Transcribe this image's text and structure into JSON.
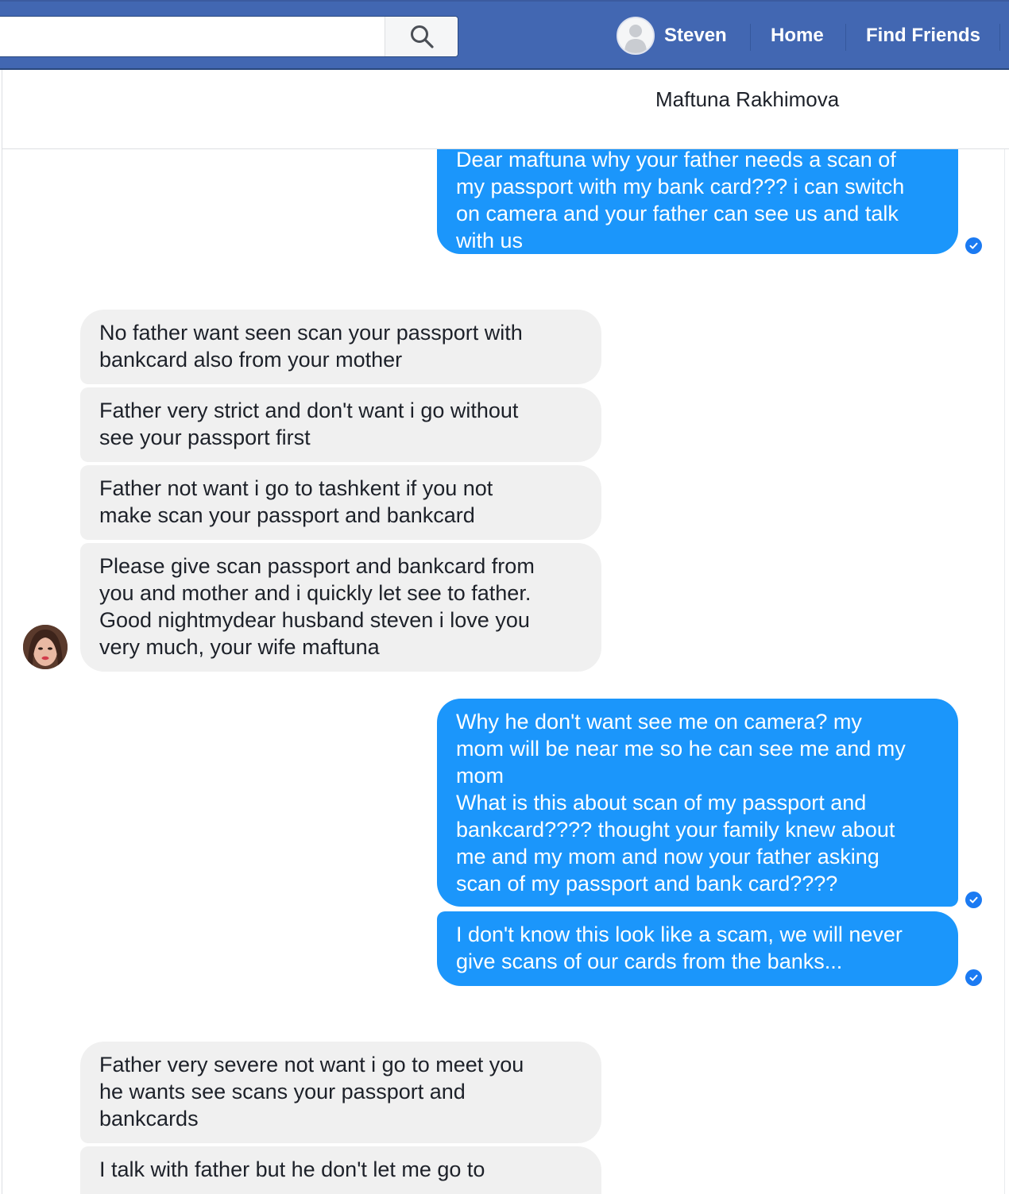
{
  "topbar": {
    "search_placeholder": "",
    "profile_name": "Steven",
    "home_label": "Home",
    "find_friends_label": "Find Friends",
    "brand_color": "#4267b2"
  },
  "conversation": {
    "title": "Maftuna Rakhimova"
  },
  "messages": [
    {
      "from": "me",
      "text": "Dear maftuna why your father needs a scan of\nmy passport with my bank card??? i can switch\non camera and your father can see us and talk\nwith us"
    },
    {
      "from": "contact",
      "text": "No father want seen scan your passport with\nbankcard also from your mother"
    },
    {
      "from": "contact",
      "text": "Father very strict and don't want i go without\nsee your passport first"
    },
    {
      "from": "contact",
      "text": "Father not want i go to tashkent if you not\nmake scan your passport and bankcard"
    },
    {
      "from": "contact",
      "text": "Please give scan passport and bankcard from\nyou and mother and i quickly let see to father.\nGood nightmydear husband steven i love you\nvery much, your wife maftuna"
    },
    {
      "from": "me",
      "text": "Why he don't want see me on camera? my\nmom will be near me so he can see me and my\nmom\nWhat is this about scan of my passport and\nbankcard???? thought your family knew about\nme and my mom and now your father asking\nscan of my passport and bank card????"
    },
    {
      "from": "me",
      "text": "I don't know this look like a scam, we will never\ngive scans of our cards from the banks..."
    },
    {
      "from": "contact",
      "text": "Father very severe not want i go to meet you\nhe wants see scans your passport and\nbankcards"
    },
    {
      "from": "contact",
      "text": "I talk with father but he don't let me go to"
    }
  ],
  "colors": {
    "outgoing_bubble": "#1b96fb",
    "incoming_bubble": "#f0f0f0",
    "seen_check": "#1b7af2"
  }
}
